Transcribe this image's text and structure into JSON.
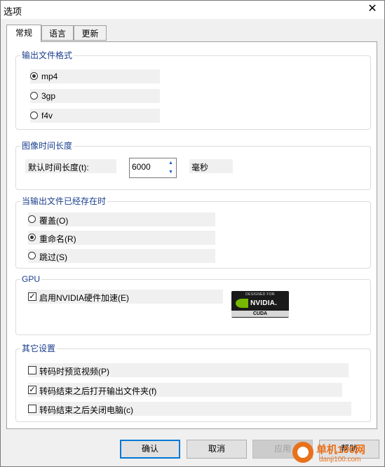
{
  "window": {
    "title": "选项",
    "close_glyph": "✕"
  },
  "tabs": [
    {
      "label": "常规",
      "active": true
    },
    {
      "label": "语言",
      "active": false
    },
    {
      "label": "更新",
      "active": false
    }
  ],
  "output_format": {
    "legend": "输出文件格式",
    "options": [
      {
        "label": "mp4",
        "selected": true
      },
      {
        "label": "3gp",
        "selected": false
      },
      {
        "label": "f4v",
        "selected": false
      }
    ]
  },
  "image_duration": {
    "legend": "图像时间长度",
    "label": "默认时间长度(t):",
    "value": "6000",
    "unit": "毫秒"
  },
  "existing_file": {
    "legend": "当输出文件已经存在时",
    "options": [
      {
        "label": "覆盖(O)",
        "selected": false
      },
      {
        "label": "重命名(R)",
        "selected": true
      },
      {
        "label": "跳过(S)",
        "selected": false
      }
    ]
  },
  "gpu": {
    "legend": "GPU",
    "checkbox_label": "启用NVIDIA硬件加速(E)",
    "checked": true,
    "badge": {
      "top": "DESIGNED FOR",
      "name": "NVIDIA.",
      "bottom": "CUDA"
    }
  },
  "other": {
    "legend": "其它设置",
    "options": [
      {
        "label": "转码时预览视频(P)",
        "checked": false
      },
      {
        "label": "转码结束之后打开输出文件夹(f)",
        "checked": true
      },
      {
        "label": "转码结束之后关闭电脑(c)",
        "checked": false
      }
    ]
  },
  "buttons": {
    "ok": "确认",
    "cancel": "取消",
    "apply": "应用",
    "help": "帮助"
  },
  "watermark": {
    "line1": "单机100网",
    "line2": "danji100.com"
  },
  "colors": {
    "legend": "#1a3e8c",
    "focus": "#0078d7",
    "nvidia_green": "#76b900",
    "watermark": "#e8711a"
  }
}
